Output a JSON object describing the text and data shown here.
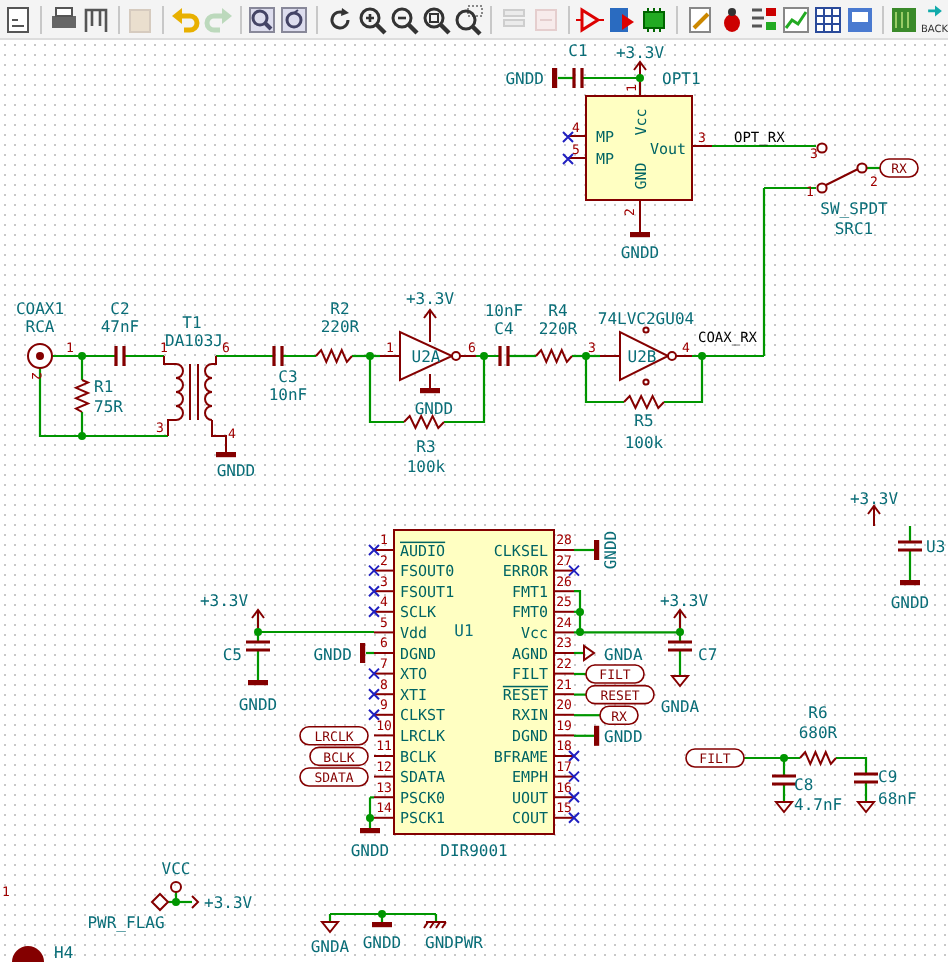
{
  "toolbar": {
    "groups": [
      [
        {
          "kind": "page",
          "disabled": false
        }
      ],
      [
        {
          "kind": "print",
          "disabled": false
        },
        {
          "kind": "plot",
          "disabled": false
        }
      ],
      [
        {
          "kind": "paste",
          "disabled": true
        }
      ],
      [
        {
          "kind": "undo",
          "disabled": false
        },
        {
          "kind": "redo",
          "disabled": true
        }
      ],
      [
        {
          "kind": "search",
          "disabled": false
        },
        {
          "kind": "replace",
          "disabled": false
        }
      ],
      [
        {
          "kind": "refresh",
          "disabled": false
        },
        {
          "kind": "zoom-in",
          "disabled": false
        },
        {
          "kind": "zoom-out",
          "disabled": false
        },
        {
          "kind": "zoom-fit",
          "disabled": false
        },
        {
          "kind": "zoom-area",
          "disabled": false
        }
      ],
      [
        {
          "kind": "hierarchy",
          "disabled": true
        },
        {
          "kind": "leave",
          "disabled": true
        }
      ],
      [
        {
          "kind": "symbol",
          "disabled": false
        },
        {
          "kind": "library",
          "disabled": false
        },
        {
          "kind": "chip",
          "disabled": false
        }
      ],
      [
        {
          "kind": "pencil",
          "disabled": false
        },
        {
          "kind": "bug",
          "disabled": false
        },
        {
          "kind": "assign",
          "disabled": false
        },
        {
          "kind": "netlist",
          "disabled": false
        },
        {
          "kind": "table",
          "disabled": false
        },
        {
          "kind": "board",
          "disabled": false
        }
      ],
      [
        {
          "kind": "pcb",
          "disabled": false
        },
        {
          "kind": "back",
          "disabled": false,
          "label": "BACK"
        }
      ]
    ]
  },
  "schematic": {
    "texts": [
      {
        "text": "+3.3V",
        "kind": "power"
      },
      {
        "text": "C1",
        "kind": "ref"
      },
      {
        "text": "GNDD",
        "kind": "power"
      },
      {
        "text": "OPT1",
        "kind": "ref"
      },
      {
        "text": "1",
        "kind": "pin_number"
      },
      {
        "text": "4",
        "kind": "pin_number"
      },
      {
        "text": "5",
        "kind": "pin_number"
      },
      {
        "text": "MP",
        "kind": "pin_name"
      },
      {
        "text": "MP",
        "kind": "pin_name"
      },
      {
        "text": "Vcc",
        "kind": "pin_name"
      },
      {
        "text": "GND",
        "kind": "pin_name"
      },
      {
        "text": "Vout",
        "kind": "pin_name"
      },
      {
        "text": "3",
        "kind": "pin_number"
      },
      {
        "text": "2",
        "kind": "pin_number"
      },
      {
        "text": "GNDD",
        "kind": "power"
      },
      {
        "text": "OPT_RX",
        "kind": "net"
      },
      {
        "text": "3",
        "kind": "pin_number"
      },
      {
        "text": "2",
        "kind": "pin_number"
      },
      {
        "text": "1",
        "kind": "pin_number"
      },
      {
        "text": "SW_SPDT",
        "kind": "value"
      },
      {
        "text": "SRC1",
        "kind": "ref"
      },
      {
        "text": "COAX1",
        "kind": "ref"
      },
      {
        "text": "RCA",
        "kind": "value"
      },
      {
        "text": "1",
        "kind": "pin_number"
      },
      {
        "text": "2",
        "kind": "pin_number"
      },
      {
        "text": "R1",
        "kind": "ref"
      },
      {
        "text": "75R",
        "kind": "value"
      },
      {
        "text": "C2",
        "kind": "ref"
      },
      {
        "text": "47nF",
        "kind": "value"
      },
      {
        "text": "T1",
        "kind": "ref"
      },
      {
        "text": "DA103J",
        "kind": "value"
      },
      {
        "text": "1",
        "kind": "pin_number"
      },
      {
        "text": "6",
        "kind": "pin_number"
      },
      {
        "text": "3",
        "kind": "pin_number"
      },
      {
        "text": "4",
        "kind": "pin_number"
      },
      {
        "text": "GNDD",
        "kind": "power"
      },
      {
        "text": "C3",
        "kind": "ref"
      },
      {
        "text": "10nF",
        "kind": "value"
      },
      {
        "text": "R2",
        "kind": "ref"
      },
      {
        "text": "220R",
        "kind": "value"
      },
      {
        "text": "+3.3V",
        "kind": "power"
      },
      {
        "text": "1",
        "kind": "pin_number"
      },
      {
        "text": "U2A",
        "kind": "ref"
      },
      {
        "text": "6",
        "kind": "pin_number"
      },
      {
        "text": "GNDD",
        "kind": "power"
      },
      {
        "text": "R3",
        "kind": "ref"
      },
      {
        "text": "100k",
        "kind": "value"
      },
      {
        "text": "10nF",
        "kind": "value"
      },
      {
        "text": "C4",
        "kind": "ref"
      },
      {
        "text": "R4",
        "kind": "ref"
      },
      {
        "text": "220R",
        "kind": "value"
      },
      {
        "text": "74LVC2GU04",
        "kind": "value"
      },
      {
        "text": "3",
        "kind": "pin_number"
      },
      {
        "text": "U2B",
        "kind": "ref"
      },
      {
        "text": "4",
        "kind": "pin_number"
      },
      {
        "text": "COAX_RX",
        "kind": "net"
      },
      {
        "text": "R5",
        "kind": "ref"
      },
      {
        "text": "100k",
        "kind": "value"
      },
      {
        "text": "+3.3V",
        "kind": "power"
      },
      {
        "text": "C5",
        "kind": "ref"
      },
      {
        "text": "GNDD",
        "kind": "power"
      },
      {
        "text": "GNDD",
        "kind": "power"
      },
      {
        "text": "GNDD",
        "kind": "power"
      },
      {
        "text": "+3.3V",
        "kind": "power"
      },
      {
        "text": "GNDA",
        "kind": "power"
      },
      {
        "text": "C7",
        "kind": "ref"
      },
      {
        "text": "GNDA",
        "kind": "power"
      },
      {
        "text": "GNDD",
        "kind": "power"
      },
      {
        "text": "+3.3V",
        "kind": "power"
      },
      {
        "text": "U3",
        "kind": "ref"
      },
      {
        "text": "GNDD",
        "kind": "power"
      },
      {
        "text": "R6",
        "kind": "ref"
      },
      {
        "text": "680R",
        "kind": "value"
      },
      {
        "text": "C8",
        "kind": "ref"
      },
      {
        "text": "4.7nF",
        "kind": "value"
      },
      {
        "text": "C9",
        "kind": "ref"
      },
      {
        "text": "68nF",
        "kind": "value"
      },
      {
        "text": "GNDD",
        "kind": "power"
      },
      {
        "text": "VCC",
        "kind": "power"
      },
      {
        "text": "+3.3V",
        "kind": "power"
      },
      {
        "text": "PWR_FLAG",
        "kind": "value"
      },
      {
        "text": "GNDA",
        "kind": "power"
      },
      {
        "text": "GNDD",
        "kind": "power"
      },
      {
        "text": "GNDPWR",
        "kind": "power"
      },
      {
        "text": "1",
        "kind": "pin_number"
      },
      {
        "text": "H4",
        "kind": "ref"
      }
    ],
    "labels": [
      {
        "text": "RX"
      },
      {
        "text": "FILT"
      },
      {
        "text": "RESET"
      },
      {
        "text": "RX"
      },
      {
        "text": "LRCLK"
      },
      {
        "text": "BCLK"
      },
      {
        "text": "SDATA"
      },
      {
        "text": "FILT"
      }
    ],
    "ic": {
      "ref": "U1",
      "value": "DIR9001",
      "left_pins": [
        {
          "number": "1",
          "name": "AUDIO",
          "overline": true,
          "no_connect": true
        },
        {
          "number": "2",
          "name": "FSOUT0",
          "overline": false,
          "no_connect": true
        },
        {
          "number": "3",
          "name": "FSOUT1",
          "overline": false,
          "no_connect": true
        },
        {
          "number": "4",
          "name": "SCLK",
          "overline": false,
          "no_connect": true
        },
        {
          "number": "5",
          "name": "Vdd",
          "overline": false,
          "no_connect": false
        },
        {
          "number": "6",
          "name": "DGND",
          "overline": false,
          "no_connect": false
        },
        {
          "number": "7",
          "name": "XTO",
          "overline": false,
          "no_connect": true
        },
        {
          "number": "8",
          "name": "XTI",
          "overline": false,
          "no_connect": true
        },
        {
          "number": "9",
          "name": "CLKST",
          "overline": false,
          "no_connect": true
        },
        {
          "number": "10",
          "name": "LRCLK",
          "overline": false,
          "no_connect": false
        },
        {
          "number": "11",
          "name": "BCLK",
          "overline": false,
          "no_connect": false
        },
        {
          "number": "12",
          "name": "SDATA",
          "overline": false,
          "no_connect": false
        },
        {
          "number": "13",
          "name": "PSCK0",
          "overline": false,
          "no_connect": false
        },
        {
          "number": "14",
          "name": "PSCK1",
          "overline": false,
          "no_connect": false
        }
      ],
      "right_pins": [
        {
          "number": "28",
          "name": "CLKSEL",
          "overline": false,
          "no_connect": false
        },
        {
          "number": "27",
          "name": "ERROR",
          "overline": false,
          "no_connect": true
        },
        {
          "number": "26",
          "name": "FMT1",
          "overline": false,
          "no_connect": false
        },
        {
          "number": "25",
          "name": "FMT0",
          "overline": false,
          "no_connect": false
        },
        {
          "number": "24",
          "name": "Vcc",
          "overline": false,
          "no_connect": false
        },
        {
          "number": "23",
          "name": "AGND",
          "overline": false,
          "no_connect": false
        },
        {
          "number": "22",
          "name": "FILT",
          "overline": false,
          "no_connect": false
        },
        {
          "number": "21",
          "name": "RESET",
          "overline": true,
          "no_connect": false
        },
        {
          "number": "20",
          "name": "RXIN",
          "overline": false,
          "no_connect": false
        },
        {
          "number": "19",
          "name": "DGND",
          "overline": false,
          "no_connect": false
        },
        {
          "number": "18",
          "name": "BFRAME",
          "overline": false,
          "no_connect": true
        },
        {
          "number": "17",
          "name": "EMPH",
          "overline": false,
          "no_connect": true
        },
        {
          "number": "16",
          "name": "UOUT",
          "overline": false,
          "no_connect": true
        },
        {
          "number": "15",
          "name": "COUT",
          "overline": false,
          "no_connect": true
        }
      ]
    }
  }
}
